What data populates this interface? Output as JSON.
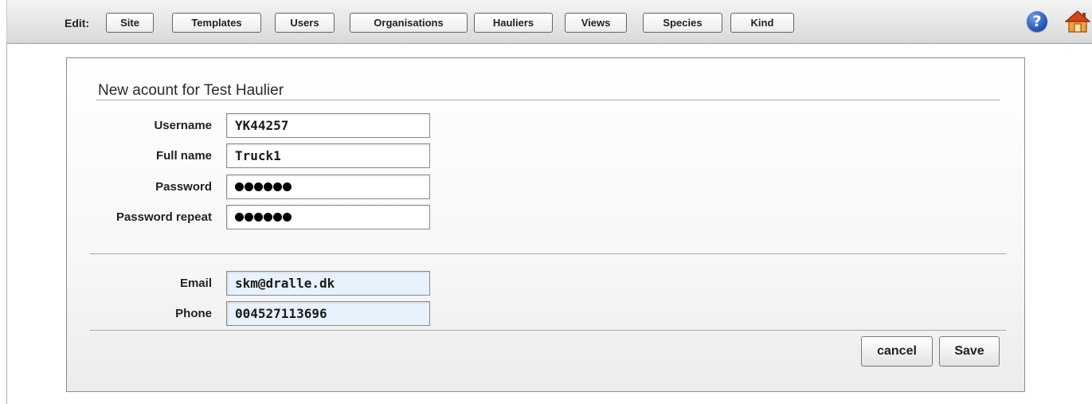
{
  "toolbar": {
    "edit_label": "Edit:",
    "buttons": [
      {
        "label": "Site"
      },
      {
        "label": "Templates"
      },
      {
        "label": "Users"
      },
      {
        "label": "Organisations"
      },
      {
        "label": "Hauliers"
      },
      {
        "label": "Views"
      },
      {
        "label": "Species"
      },
      {
        "label": "Kind"
      }
    ],
    "help_icon": "help-icon",
    "help_glyph": "?",
    "home_icon": "home-icon"
  },
  "form": {
    "title": "New acount for Test Haulier",
    "fields": {
      "username": {
        "label": "Username",
        "value": "YK44257"
      },
      "full_name": {
        "label": "Full name",
        "value": "Truck1"
      },
      "password": {
        "label": "Password",
        "masked_chars": 6
      },
      "password_repeat": {
        "label": "Password repeat",
        "masked_chars": 6
      },
      "email": {
        "label": "Email",
        "value": "skm@dralle.dk"
      },
      "phone": {
        "label": "Phone",
        "value": "004527113696"
      }
    },
    "cancel_label": "cancel",
    "save_label": "Save"
  },
  "colors": {
    "toolbar_bg": "#d9d9d9",
    "contact_field_bg": "#e7f2fc",
    "help_icon": "#1f4fb0"
  }
}
